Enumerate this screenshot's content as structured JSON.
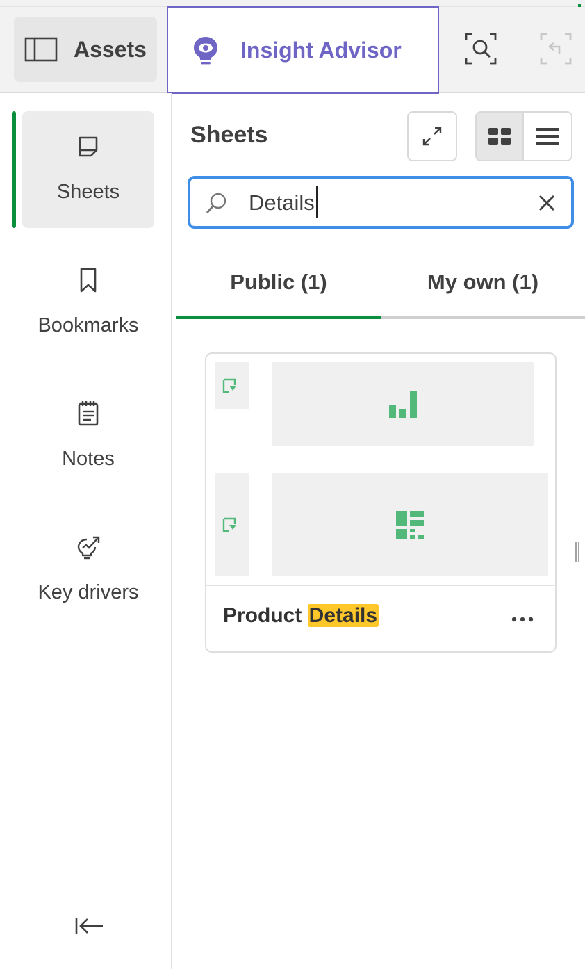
{
  "toolbar": {
    "assets_label": "Assets",
    "insight_label": "Insight Advisor",
    "assets_icon": "panel-icon",
    "insight_icon": "lightbulb-eye-icon",
    "smart_search_icon": "smart-search-icon",
    "step_back_icon": "step-back-icon"
  },
  "nav": {
    "items": [
      {
        "label": "Sheets",
        "icon": "sheet-icon",
        "active": true
      },
      {
        "label": "Bookmarks",
        "icon": "bookmark-icon",
        "active": false
      },
      {
        "label": "Notes",
        "icon": "notes-icon",
        "active": false
      },
      {
        "label": "Key drivers",
        "icon": "key-drivers-icon",
        "active": false
      }
    ],
    "collapse_icon": "collapse-left-icon"
  },
  "panel": {
    "title": "Sheets",
    "search": {
      "value": "Details",
      "placeholder": ""
    },
    "tabs": [
      {
        "label": "Public (1)",
        "active": true
      },
      {
        "label": "My own (1)",
        "active": false
      }
    ],
    "view_mode": "grid"
  },
  "sheets": [
    {
      "title_prefix": "Product ",
      "title_match": "Details",
      "thumbnail_icons": [
        "bar-chart-icon",
        "table-grid-icon"
      ]
    }
  ],
  "colors": {
    "accent_green": "#0a8f3c",
    "insight_purple": "#6e65c5",
    "search_focus_blue": "#3f8ee8",
    "highlight_yellow": "#ffc72a",
    "thumb_icon_green": "#52b97a"
  }
}
